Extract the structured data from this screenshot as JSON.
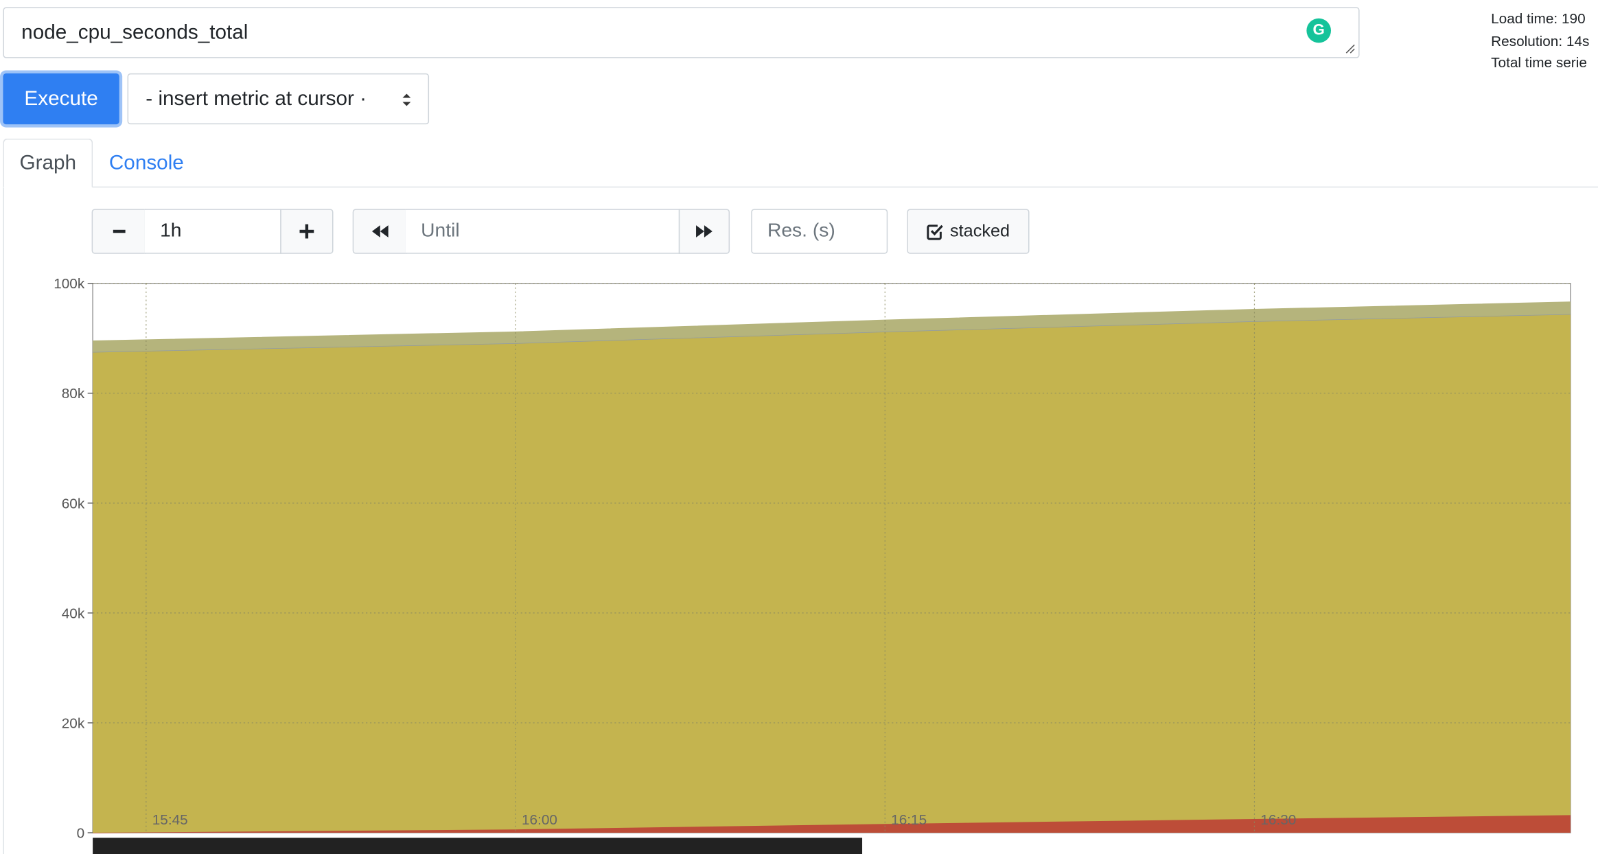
{
  "query": {
    "expression": "node_cpu_seconds_total",
    "extension_icon": "grammarly-icon",
    "extension_letter": "G"
  },
  "stats": {
    "load_time": "Load time: 190",
    "resolution": "Resolution: 14s",
    "total_series": "Total time serie"
  },
  "toolbar": {
    "execute_label": "Execute",
    "metric_select_value": "- insert metric at cursor ·"
  },
  "tabs": [
    {
      "label": "Graph",
      "active": true
    },
    {
      "label": "Console",
      "active": false
    }
  ],
  "graph_controls": {
    "range_value": "1h",
    "until_placeholder": "Until",
    "res_placeholder": "Res. (s)",
    "stacked_label": "stacked",
    "stacked_checked": true
  },
  "colors": {
    "execute_bg": "#2f7ff2",
    "series_top": "#b5b47c",
    "series_main": "#c4b44f",
    "series_bottom": "#bd4d38"
  },
  "chart_data": {
    "type": "area",
    "stacked": true,
    "x_tick_labels": [
      "15:45",
      "16:00",
      "16:15",
      "16:30"
    ],
    "y_tick_labels": [
      "0",
      "20k",
      "40k",
      "60k",
      "80k",
      "100k"
    ],
    "ylim": [
      0,
      100000
    ],
    "xlim": [
      "15:42:50",
      "16:42:50"
    ],
    "grid": true,
    "series": [
      {
        "color": "#bd4d38",
        "x": [
          "15:42:50",
          "16:00",
          "16:15",
          "16:30",
          "16:42:50"
        ],
        "values": [
          0,
          600,
          1600,
          2500,
          3200
        ]
      },
      {
        "color": "#c4b44f",
        "x": [
          "15:42:50",
          "16:00",
          "16:15",
          "16:30",
          "16:42:50"
        ],
        "values": [
          87500,
          88500,
          89600,
          90600,
          91200
        ]
      },
      {
        "color": "#b5b47c",
        "x": [
          "15:42:50",
          "16:00",
          "16:15",
          "16:30",
          "16:42:50"
        ],
        "values": [
          2000,
          2050,
          2100,
          2150,
          2200
        ]
      }
    ]
  }
}
